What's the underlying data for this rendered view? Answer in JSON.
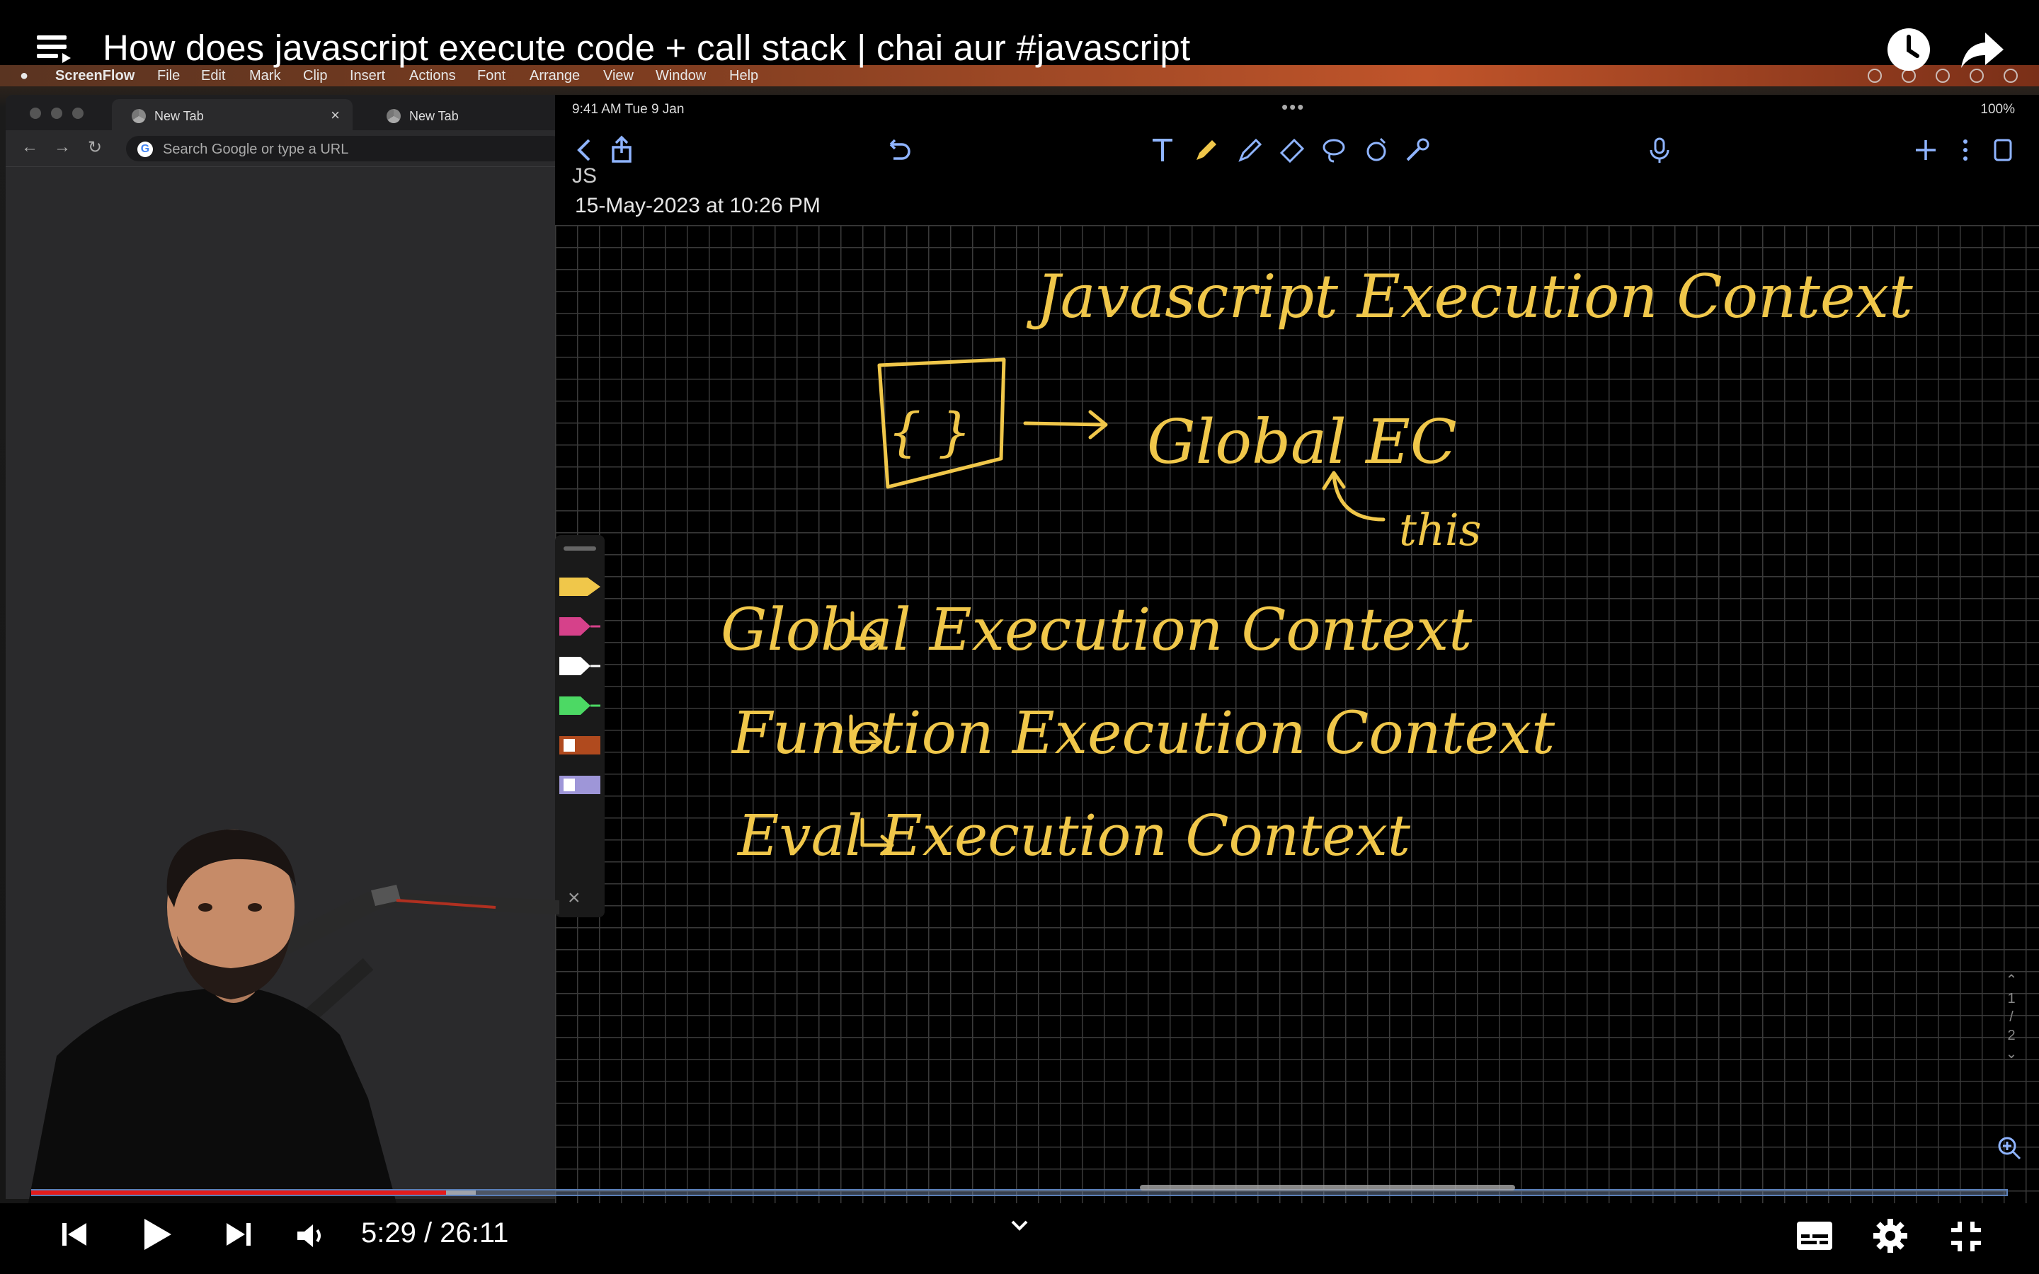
{
  "video": {
    "title": "How does javascript execute code + call stack | chai aur #javascript",
    "current_time": "5:29",
    "separator": "/",
    "duration": "26:11",
    "played_fraction": 0.21,
    "buffered_fraction": 0.225
  },
  "screen": {
    "app_name": "ScreenFlow",
    "menu": [
      "File",
      "Edit",
      "Mark",
      "Clip",
      "Insert",
      "Actions",
      "Font",
      "Arrange",
      "View",
      "Window",
      "Help"
    ],
    "chrome": {
      "tabs": [
        "New Tab",
        "New Tab"
      ],
      "close_glyph": "×",
      "omnibox_placeholder": "Search Google or type a URL"
    },
    "ipad": {
      "status_time": "9:41 AM  Tue 9 Jan",
      "status_dots": "•••",
      "battery": "100%",
      "note_header": "JS",
      "note_date": "15-May-2023 at 10:26 PM",
      "pager": [
        "1",
        "/",
        "2"
      ],
      "palette_close": "×"
    },
    "handwriting": {
      "title": "Javascript Execution Context",
      "braces": "{ }",
      "global_ec": "Global  EC",
      "this_label": "this",
      "items": [
        "Global  Execution  Context",
        "Function  Execution  Context",
        "Eval  Execution  Context"
      ],
      "ink_color": "#f0c74a"
    }
  }
}
